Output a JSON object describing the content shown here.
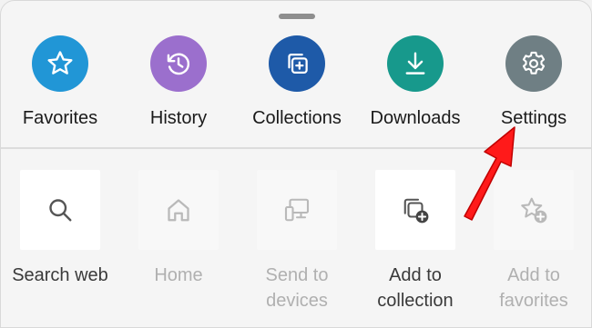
{
  "colors": {
    "favorites": "#2196d6",
    "history": "#9b6fcd",
    "collections": "#1e5aa8",
    "downloads": "#17998c",
    "settings": "#6f7f84",
    "arrow": "#ff1a1a"
  },
  "top_actions": [
    {
      "label": "Favorites",
      "icon": "star-icon"
    },
    {
      "label": "History",
      "icon": "history-icon"
    },
    {
      "label": "Collections",
      "icon": "collections-icon"
    },
    {
      "label": "Downloads",
      "icon": "download-icon"
    },
    {
      "label": "Settings",
      "icon": "gear-icon"
    }
  ],
  "bottom_actions": [
    {
      "label": "Search web",
      "icon": "search-icon",
      "enabled": true
    },
    {
      "label": "Home",
      "icon": "home-icon",
      "enabled": false
    },
    {
      "label": "Send to devices",
      "icon": "devices-icon",
      "enabled": false
    },
    {
      "label": "Add to collection",
      "icon": "add-collection-icon",
      "enabled": true
    },
    {
      "label": "Add to favorites",
      "icon": "add-favorite-icon",
      "enabled": false
    }
  ],
  "annotation": {
    "icon": "red-arrow-icon",
    "target": "Settings"
  }
}
